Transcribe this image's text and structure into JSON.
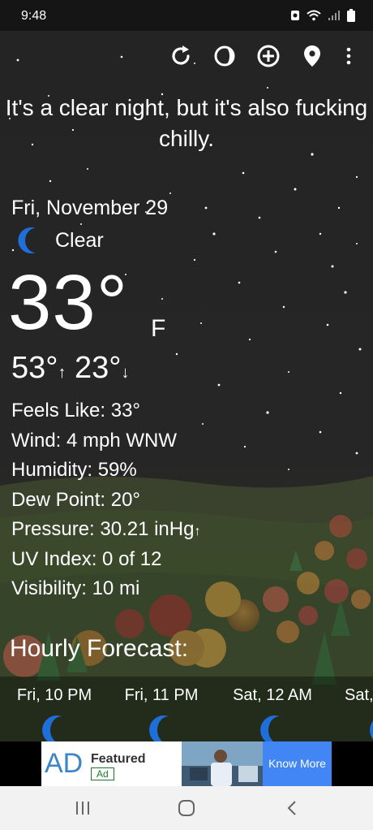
{
  "status_bar": {
    "time": "9:48"
  },
  "toolbar": {
    "icons": [
      "refresh-icon",
      "moon-phase-icon",
      "add-location-icon",
      "location-pin-icon",
      "more-vert-icon"
    ]
  },
  "headline": "It's a clear night, but it's also fucking chilly.",
  "current": {
    "date": "Fri, November 29",
    "condition": "Clear",
    "temperature": "33°",
    "unit": "F",
    "high": "53°",
    "low": "23°",
    "high_arrow": "↑",
    "low_arrow": "↓"
  },
  "details": {
    "feels_like": "Feels Like:  33°",
    "wind": "Wind:  4 mph WNW",
    "humidity": "Humidity:  59%",
    "dew_point": "Dew Point:  20°",
    "pressure": "Pressure:  30.21 inHg",
    "pressure_arrow": "↑",
    "uv_index": "UV Index:  0 of 12",
    "visibility": "Visibility:  10 mi"
  },
  "hourly": {
    "title": "Hourly Forecast:",
    "items": [
      {
        "time": "Fri, 10 PM"
      },
      {
        "time": "Fri, 11 PM"
      },
      {
        "time": "Sat, 12 AM"
      },
      {
        "time": "Sat,"
      }
    ]
  },
  "ad": {
    "logo": "AD",
    "featured": "Featured",
    "tag": "Ad",
    "cta": "Know More"
  },
  "colors": {
    "moon": "#1e6fd9",
    "background": "#262626",
    "ad_cta": "#4285f4"
  }
}
